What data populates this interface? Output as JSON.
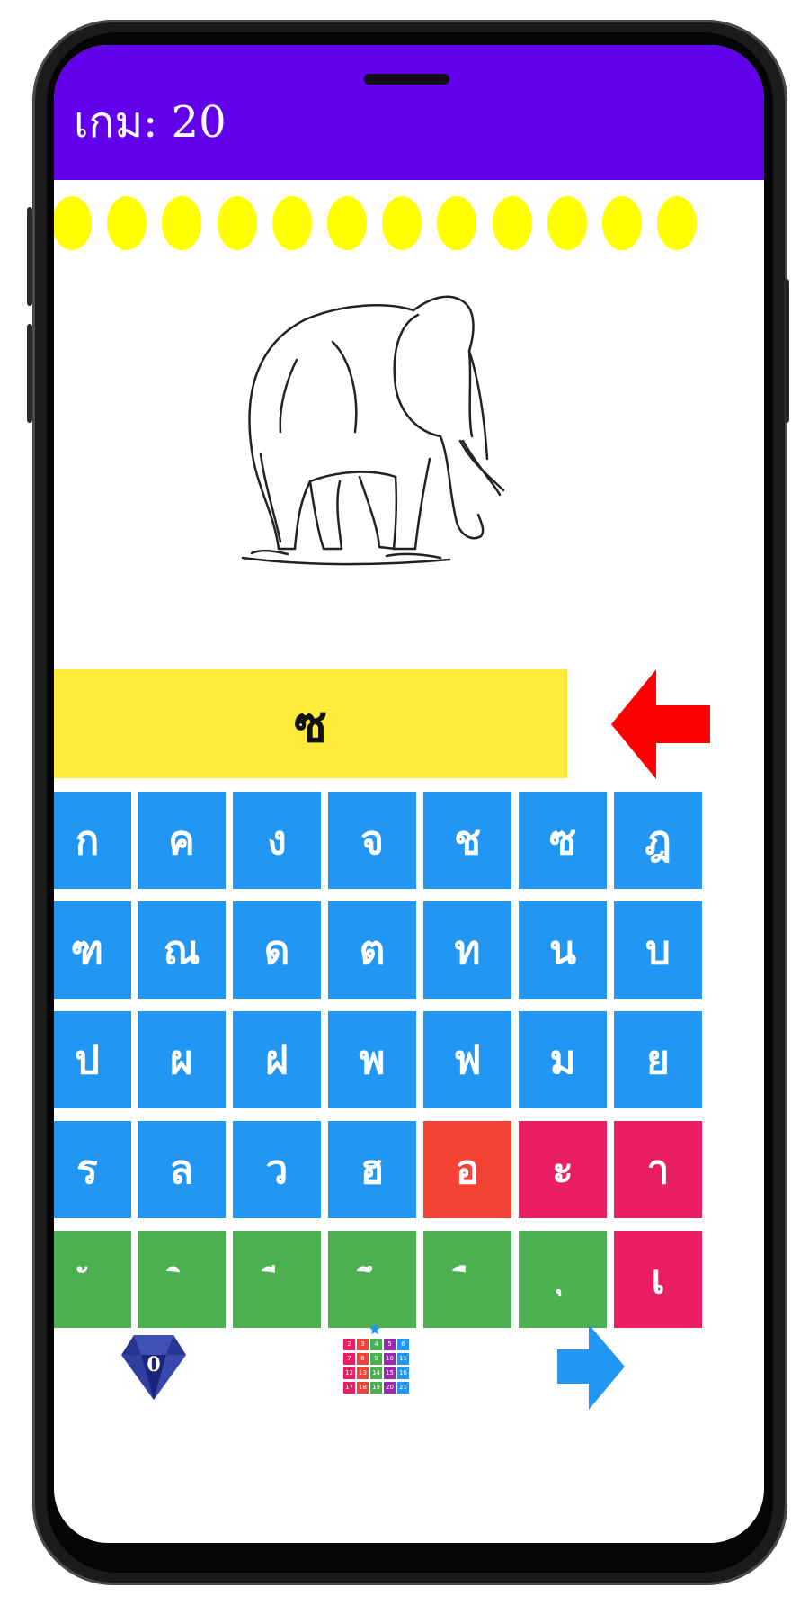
{
  "header": {
    "game_label": "เกม: 20"
  },
  "progress": {
    "dot_count": 12,
    "dot_color": "#ffff00"
  },
  "picture": {
    "icon": "elephant-drawing"
  },
  "answer": {
    "text": "ซ",
    "color": "#ffeb3b"
  },
  "controls": {
    "backspace_icon": "back-arrow-icon",
    "backspace_color": "#ff0000"
  },
  "keyboard": {
    "rows": [
      [
        {
          "label": "ก",
          "color": "blue"
        },
        {
          "label": "ค",
          "color": "blue"
        },
        {
          "label": "ง",
          "color": "blue"
        },
        {
          "label": "จ",
          "color": "blue"
        },
        {
          "label": "ช",
          "color": "blue"
        },
        {
          "label": "ซ",
          "color": "blue"
        },
        {
          "label": "ฎ",
          "color": "blue"
        }
      ],
      [
        {
          "label": "ฑ",
          "color": "blue"
        },
        {
          "label": "ณ",
          "color": "blue"
        },
        {
          "label": "ด",
          "color": "blue"
        },
        {
          "label": "ต",
          "color": "blue"
        },
        {
          "label": "ท",
          "color": "blue"
        },
        {
          "label": "น",
          "color": "blue"
        },
        {
          "label": "บ",
          "color": "blue"
        }
      ],
      [
        {
          "label": "ป",
          "color": "blue"
        },
        {
          "label": "ผ",
          "color": "blue"
        },
        {
          "label": "ฝ",
          "color": "blue"
        },
        {
          "label": "พ",
          "color": "blue"
        },
        {
          "label": "ฟ",
          "color": "blue"
        },
        {
          "label": "ม",
          "color": "blue"
        },
        {
          "label": "ย",
          "color": "blue"
        }
      ],
      [
        {
          "label": "ร",
          "color": "blue"
        },
        {
          "label": "ล",
          "color": "blue"
        },
        {
          "label": "ว",
          "color": "blue"
        },
        {
          "label": "ฮ",
          "color": "blue"
        },
        {
          "label": "อ",
          "color": "red"
        },
        {
          "label": "ะ",
          "color": "pink"
        },
        {
          "label": "า",
          "color": "pink"
        }
      ],
      [
        {
          "label": "ั",
          "color": "green"
        },
        {
          "label": "ิ",
          "color": "green"
        },
        {
          "label": "ี",
          "color": "green"
        },
        {
          "label": "ึ",
          "color": "green"
        },
        {
          "label": "ื",
          "color": "green"
        },
        {
          "label": "ุ",
          "color": "green"
        },
        {
          "label": "เ",
          "color": "pink"
        }
      ]
    ]
  },
  "footer": {
    "gem_count": "0",
    "levels": [
      "2",
      "3",
      "4",
      "5",
      "6",
      "7",
      "8",
      "9",
      "10",
      "11",
      "12",
      "13",
      "14",
      "15",
      "16",
      "17",
      "18",
      "19",
      "20",
      "21"
    ],
    "next_icon": "next-arrow-icon"
  }
}
